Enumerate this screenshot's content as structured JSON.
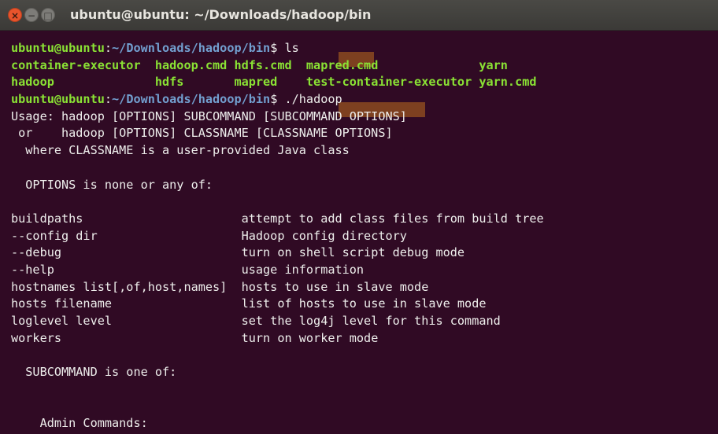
{
  "window": {
    "title": "ubuntu@ubuntu: ~/Downloads/hadoop/bin",
    "close_glyph": "×",
    "min_glyph": "−",
    "max_glyph": "□"
  },
  "prompt": {
    "user_host": "ubuntu@ubuntu",
    "path": "~/Downloads/hadoop/bin",
    "symbol": "$"
  },
  "commands": [
    " ls",
    " ./hadoop"
  ],
  "ls_output": [
    [
      "container-executor",
      "hadoop.cmd",
      "hdfs.cmd",
      "mapred.cmd",
      "yarn"
    ],
    [
      "hadoop",
      "hdfs",
      "mapred",
      "test-container-executor",
      "yarn.cmd"
    ]
  ],
  "usage_lines": [
    "Usage: hadoop [OPTIONS] SUBCOMMAND [SUBCOMMAND OPTIONS]",
    " or    hadoop [OPTIONS] CLASSNAME [CLASSNAME OPTIONS]",
    "  where CLASSNAME is a user-provided Java class",
    "",
    "  OPTIONS is none or any of:",
    ""
  ],
  "options": [
    {
      "name": "buildpaths",
      "desc": "attempt to add class files from build tree"
    },
    {
      "name": "--config dir",
      "desc": "Hadoop config directory"
    },
    {
      "name": "--debug",
      "desc": "turn on shell script debug mode"
    },
    {
      "name": "--help",
      "desc": "usage information"
    },
    {
      "name": "hostnames list[,of,host,names]",
      "desc": "hosts to use in slave mode"
    },
    {
      "name": "hosts filename",
      "desc": "list of hosts to use in slave mode"
    },
    {
      "name": "loglevel level",
      "desc": "set the log4j level for this command"
    },
    {
      "name": "workers",
      "desc": "turn on worker mode"
    }
  ],
  "tail_lines": [
    "",
    "  SUBCOMMAND is one of:",
    "",
    "",
    "    Admin Commands:"
  ],
  "colors": {
    "background": "#300a24",
    "prompt_user": "#8ae234",
    "prompt_path": "#729fcf",
    "text": "#eeeeec",
    "close_button": "#e8542c"
  }
}
